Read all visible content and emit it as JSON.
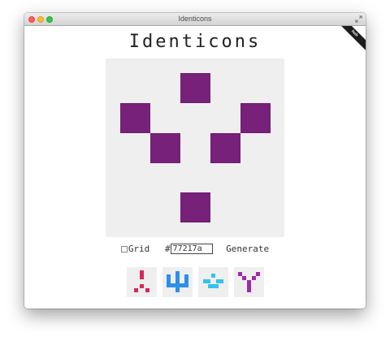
{
  "window": {
    "title": "Identicons",
    "ribbon_text": "hub"
  },
  "app": {
    "title": "Identicons"
  },
  "identicon": {
    "color": "#77217a",
    "background": "#efefef"
  },
  "controls": {
    "grid_label": "Grid",
    "grid_checked": false,
    "hash_symbol": "#",
    "color_value": "77217a",
    "generate_label": "Generate"
  },
  "swatches": [
    {
      "color": "#d6295a"
    },
    {
      "color": "#2e8fe8"
    },
    {
      "color": "#35c2ee"
    },
    {
      "color": "#a02aa8"
    }
  ]
}
